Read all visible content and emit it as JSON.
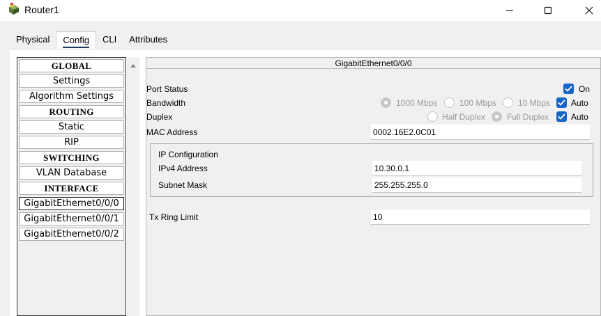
{
  "window": {
    "title": "Router1",
    "icon": "router-icon"
  },
  "tabs": [
    {
      "label": "Physical"
    },
    {
      "label": "Config"
    },
    {
      "label": "CLI"
    },
    {
      "label": "Attributes"
    }
  ],
  "active_tab": "Config",
  "sidebar": {
    "items": [
      {
        "label": "GLOBAL",
        "header": true
      },
      {
        "label": "Settings"
      },
      {
        "label": "Algorithm Settings"
      },
      {
        "label": "ROUTING",
        "header": true
      },
      {
        "label": "Static"
      },
      {
        "label": "RIP"
      },
      {
        "label": "SWITCHING",
        "header": true
      },
      {
        "label": "VLAN Database"
      },
      {
        "label": "INTERFACE",
        "header": true
      },
      {
        "label": "GigabitEthernet0/0/0",
        "selected": true
      },
      {
        "label": "GigabitEthernet0/0/1"
      },
      {
        "label": "GigabitEthernet0/0/2"
      }
    ]
  },
  "interface": {
    "title": "GigabitEthernet0/0/0",
    "port_status": {
      "label": "Port Status",
      "on_label": "On",
      "on_checked": true
    },
    "bandwidth": {
      "label": "Bandwidth",
      "options": [
        "1000 Mbps",
        "100 Mbps",
        "10 Mbps"
      ],
      "selected": "1000 Mbps",
      "auto_label": "Auto",
      "auto_checked": true
    },
    "duplex": {
      "label": "Duplex",
      "options": [
        "Half Duplex",
        "Full Duplex"
      ],
      "selected": "Full Duplex",
      "auto_label": "Auto",
      "auto_checked": true
    },
    "mac": {
      "label": "MAC Address",
      "value": "0002.16E2.0C01"
    },
    "ip_config": {
      "title": "IP Configuration",
      "ipv4_label": "IPv4 Address",
      "ipv4_value": "10.30.0.1",
      "mask_label": "Subnet Mask",
      "mask_value": "255.255.255.0"
    },
    "tx_ring": {
      "label": "Tx Ring Limit",
      "value": "10"
    }
  },
  "colors": {
    "checkbox": "#1a64c8",
    "tab_underline": "#1e3a5f"
  }
}
